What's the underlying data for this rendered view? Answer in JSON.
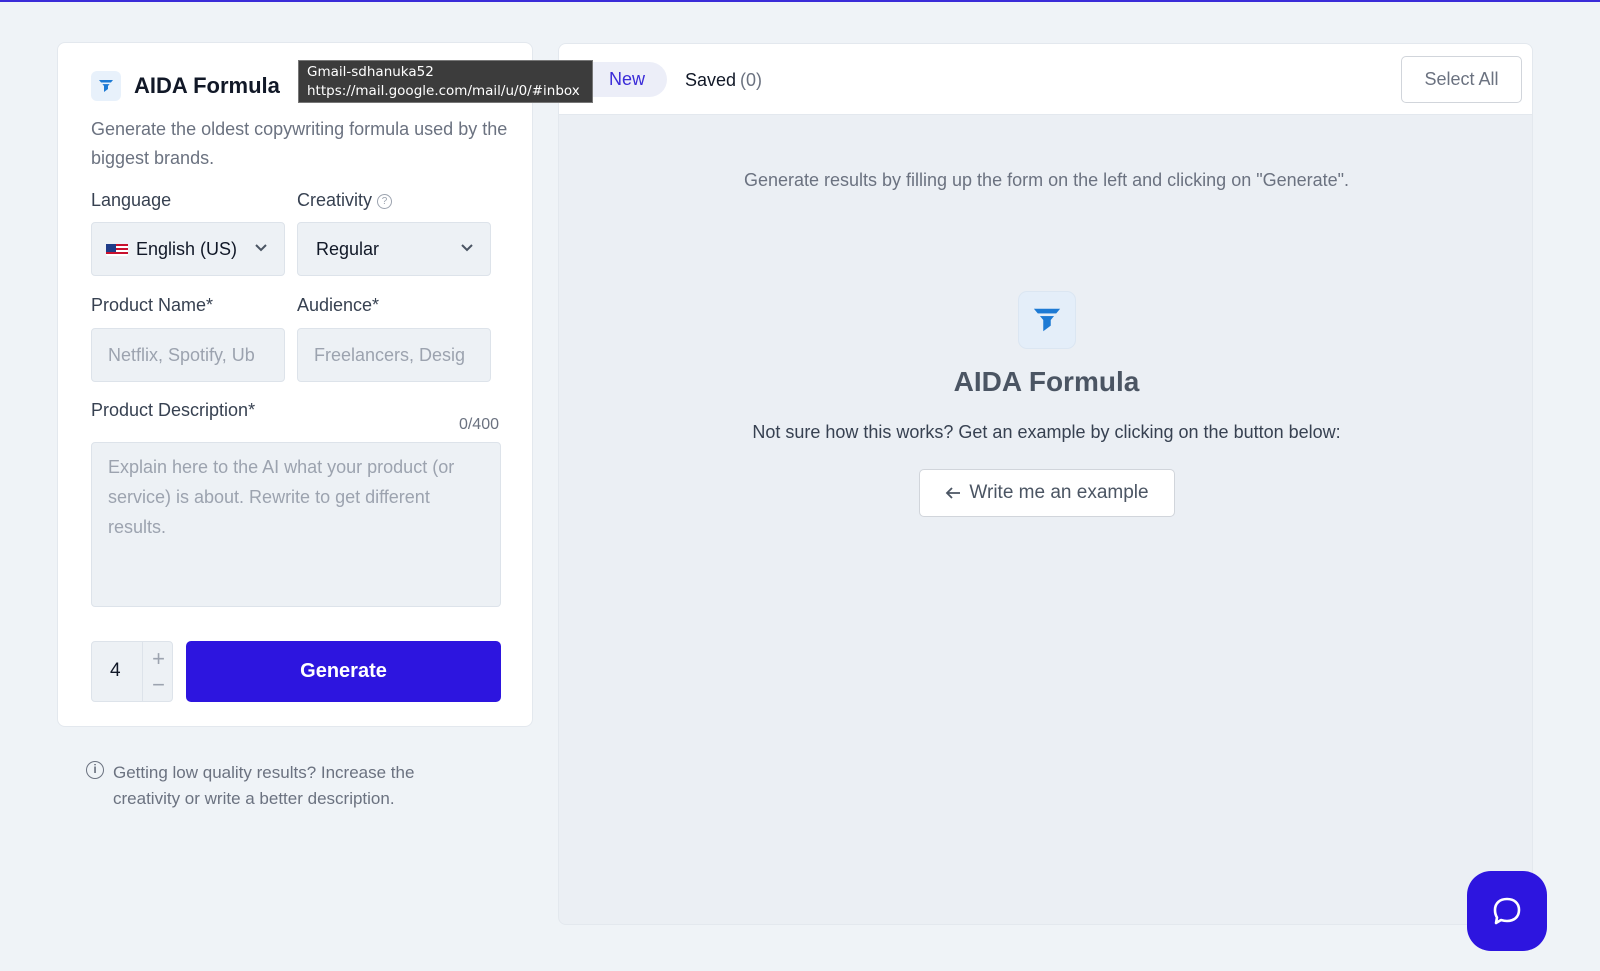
{
  "colors": {
    "accent": "#2d15df",
    "icon_blue": "#1d7ad4"
  },
  "tool": {
    "title": "AIDA Formula",
    "description": "Generate the oldest copywriting formula used by the biggest brands."
  },
  "form": {
    "language_label": "Language",
    "language_value": "English (US)",
    "creativity_label": "Creativity",
    "creativity_value": "Regular",
    "product_name_label": "Product Name*",
    "product_name_placeholder": "Netflix, Spotify, Ub",
    "audience_label": "Audience*",
    "audience_placeholder": "Freelancers, Desig",
    "description_label": "Product Description*",
    "description_counter": "0/400",
    "description_placeholder": "Explain here to the AI what your product (or service) is about. Rewrite to get different results.",
    "quantity": "4",
    "generate_label": "Generate"
  },
  "tip": "Getting low quality results? Increase the creativity or write a better description.",
  "results": {
    "tab_new": "New",
    "tab_saved": "Saved",
    "saved_count": "(0)",
    "select_all": "Select All",
    "empty_hint": "Generate results by filling up the form on the left and clicking on \"Generate\".",
    "title": "AIDA Formula",
    "subtitle": "Not sure how this works? Get an example by clicking on the button below:",
    "example_button": "Write me an example"
  },
  "tooltip": {
    "line1": "Gmail-sdhanuka52",
    "line2": "https://mail.google.com/mail/u/0/#inbox"
  },
  "icons": [
    "funnel-icon",
    "chevron-down-icon",
    "help-icon",
    "info-icon",
    "arrow-left-icon",
    "chat-icon",
    "us-flag-icon"
  ]
}
